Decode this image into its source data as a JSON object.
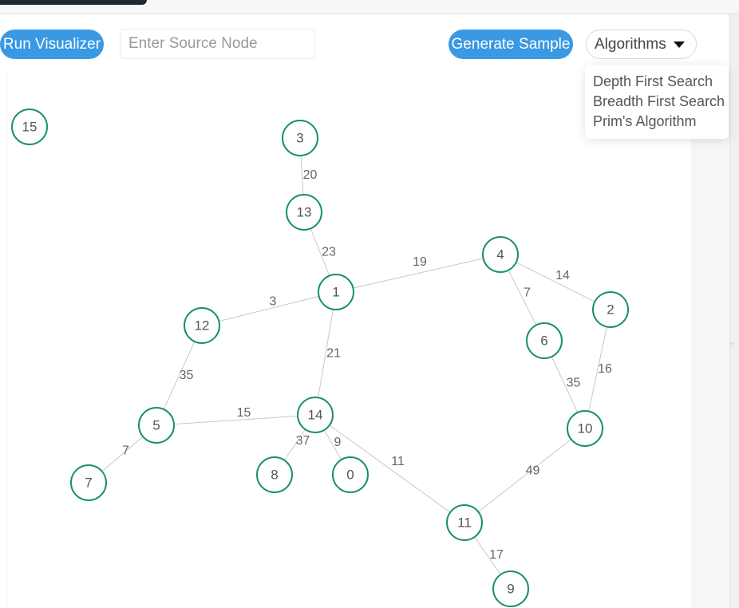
{
  "toolbar": {
    "run_label": "Run Visualizer",
    "source_placeholder": "Enter Source Node",
    "source_value": "",
    "generate_label": "Generate Sample",
    "algorithms_label": "Algorithms"
  },
  "dropdown": {
    "items": [
      "Depth First Search",
      "Breadth First Search",
      "Prim's Algorithm"
    ]
  },
  "colors": {
    "accent": "#3a99e3",
    "node_stroke": "#1a8f6e",
    "edge": "#c8c8c8",
    "topbar_tab": "#1f2732"
  },
  "graph": {
    "nodes": [
      "15",
      "3",
      "13",
      "4",
      "1",
      "2",
      "12",
      "6",
      "5",
      "14",
      "10",
      "7",
      "8",
      "0",
      "11",
      "9"
    ],
    "edges": [
      {
        "from": "3",
        "to": "13",
        "weight": "20"
      },
      {
        "from": "13",
        "to": "1",
        "weight": "23"
      },
      {
        "from": "1",
        "to": "4",
        "weight": "19"
      },
      {
        "from": "4",
        "to": "2",
        "weight": "14"
      },
      {
        "from": "4",
        "to": "6",
        "weight": "7"
      },
      {
        "from": "1",
        "to": "12",
        "weight": "3"
      },
      {
        "from": "2",
        "to": "10",
        "weight": "16"
      },
      {
        "from": "1",
        "to": "14",
        "weight": "21"
      },
      {
        "from": "12",
        "to": "5",
        "weight": "35"
      },
      {
        "from": "6",
        "to": "10",
        "weight": "35"
      },
      {
        "from": "5",
        "to": "14",
        "weight": "15"
      },
      {
        "from": "14",
        "to": "8",
        "weight": "37"
      },
      {
        "from": "14",
        "to": "0",
        "weight": "9"
      },
      {
        "from": "5",
        "to": "7",
        "weight": "7"
      },
      {
        "from": "14",
        "to": "11",
        "weight": "11"
      },
      {
        "from": "10",
        "to": "11",
        "weight": "49"
      },
      {
        "from": "11",
        "to": "9",
        "weight": "17"
      }
    ]
  }
}
